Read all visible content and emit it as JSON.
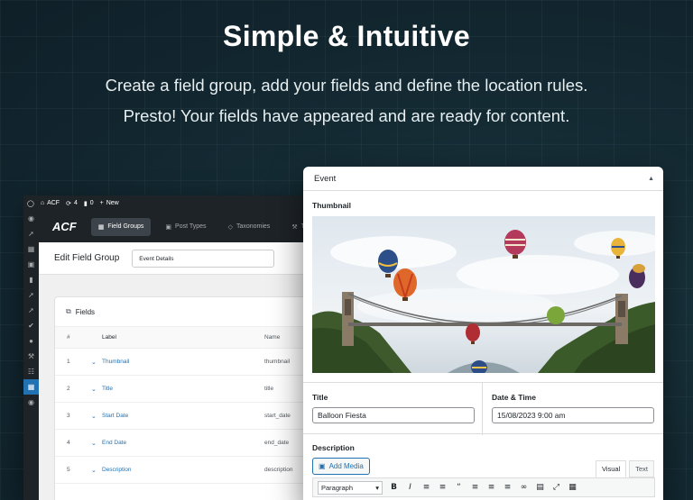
{
  "hero": {
    "title": "Simple & Intuitive",
    "subtitle_line1": "Create a field group, add your fields and define the location rules.",
    "subtitle_line2": "Presto! Your fields have appeared and are ready for content."
  },
  "admin_bar": {
    "site": "ACF",
    "updates": "4",
    "comments": "0",
    "new": "New"
  },
  "acf_nav": {
    "logo": "ACF",
    "tabs": [
      {
        "label": "Field Groups",
        "icon": "field-groups-icon",
        "active": true
      },
      {
        "label": "Post Types",
        "icon": "post-types-icon",
        "active": false
      },
      {
        "label": "Taxonomies",
        "icon": "tag-icon",
        "active": false
      },
      {
        "label": "To",
        "icon": "tools-icon",
        "active": false
      }
    ]
  },
  "edit_header": {
    "title": "Edit Field Group",
    "group_title_value": "Event Details"
  },
  "fields_table": {
    "heading": "Fields",
    "col_num": "#",
    "col_label": "Label",
    "col_name": "Name",
    "rows": [
      {
        "num": "1",
        "label": "Thumbnail",
        "name": "thumbnail"
      },
      {
        "num": "2",
        "label": "Title",
        "name": "title"
      },
      {
        "num": "3",
        "label": "Start Date",
        "name": "start_date"
      },
      {
        "num": "4",
        "label": "End Date",
        "name": "end_date"
      },
      {
        "num": "5",
        "label": "Description",
        "name": "description"
      }
    ]
  },
  "event_panel": {
    "title": "Event",
    "thumbnail_label": "Thumbnail",
    "title_label": "Title",
    "title_value": "Balloon Fiesta",
    "datetime_label": "Date & Time",
    "datetime_value": "15/08/2023 9:00 am",
    "description_label": "Description",
    "add_media": "Add Media",
    "tab_visual": "Visual",
    "tab_text": "Text",
    "format_select": "Paragraph"
  },
  "colors": {
    "background": "#142a33",
    "wp_dark": "#1d2327",
    "wp_blue": "#2271b1"
  }
}
